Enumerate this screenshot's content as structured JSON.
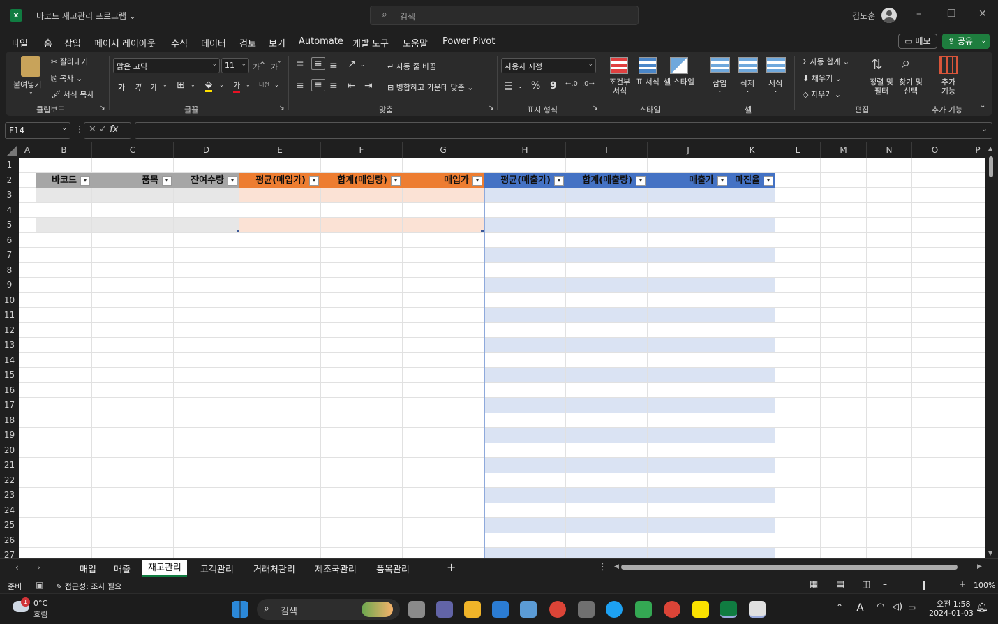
{
  "window": {
    "title": "바코드 재고관리 프로그램 ⌄",
    "search_placeholder": "검색",
    "user": "김도훈"
  },
  "menu": {
    "tabs": [
      "파일",
      "홈",
      "삽입",
      "페이지 레이아웃",
      "수식",
      "데이터",
      "검토",
      "보기",
      "Automate",
      "개발 도구",
      "도움말",
      "Power Pivot"
    ],
    "active": "홈",
    "memo": "메모",
    "share": "공유"
  },
  "ribbon": {
    "clipboard": {
      "paste": "붙여넣기",
      "cut": "잘라내기",
      "copy": "복사",
      "format_painter": "서식 복사",
      "label": "클립보드"
    },
    "font": {
      "name": "맑은 고딕",
      "size": "11",
      "label": "글꼴",
      "bold": "가",
      "italic": "가",
      "underline": "가",
      "font_color": "가",
      "phonetic": "내천",
      "grow": "가",
      "shrink": "가"
    },
    "align": {
      "wrap": "자동 줄 바꿈",
      "merge": "병합하고 가운데 맞춤",
      "label": "맞춤"
    },
    "number": {
      "format": "사용자 지정",
      "label": "표시 형식",
      "percent": "%",
      "comma": "9"
    },
    "styles": {
      "conditional": "조건부 서식",
      "table": "표 서식",
      "cell": "셀 스타일",
      "label": "스타일"
    },
    "cells": {
      "insert": "삽입",
      "delete": "삭제",
      "format": "서식",
      "label": "셀"
    },
    "editing": {
      "autosum": "자동 합계",
      "fill": "채우기",
      "clear": "지우기",
      "sort": "정렬 및 필터",
      "find": "찾기 및 선택",
      "label": "편집"
    },
    "addins": {
      "button": "추가 기능",
      "label": "추가 기능"
    }
  },
  "formula_bar": {
    "name_box": "F14",
    "fx": "fx",
    "value": ""
  },
  "columns": [
    "A",
    "B",
    "C",
    "D",
    "E",
    "F",
    "G",
    "H",
    "I",
    "J",
    "K",
    "L",
    "M",
    "N",
    "O",
    "P"
  ],
  "rows": [
    "1",
    "2",
    "3",
    "4",
    "5",
    "6",
    "7",
    "8",
    "9",
    "10",
    "11",
    "12",
    "13",
    "14",
    "15",
    "16",
    "17",
    "18",
    "19",
    "20",
    "21",
    "22",
    "23",
    "24",
    "25",
    "26",
    "27"
  ],
  "table_headers": [
    "바코드",
    "품목",
    "잔여수량",
    "평균(매입가)",
    "합계(매입량)",
    "매입가",
    "평균(매출가)",
    "합계(매출량)",
    "매출가",
    "마진율"
  ],
  "colors": {
    "gray_header": "#a6a6a6",
    "orange_header": "#ed7d31",
    "blue_header": "#4472c4",
    "gray_band": "#e7e7e7",
    "orange_band": "#fbe2d5",
    "blue_band": "#dae3f3",
    "excel_green": "#107c41"
  },
  "sheet_tabs": [
    "매입",
    "매출",
    "재고관리",
    "고객관리",
    "거래처관리",
    "제조국관리",
    "품목관리"
  ],
  "active_sheet": "재고관리",
  "status": {
    "ready": "준비",
    "accessibility": "접근성: 조사 필요",
    "zoom": "100%"
  },
  "taskbar": {
    "weather_temp": "0°C",
    "weather_desc": "흐림",
    "search": "검색",
    "time": "오전 1:58",
    "date": "2024-01-03",
    "badge": "1"
  }
}
